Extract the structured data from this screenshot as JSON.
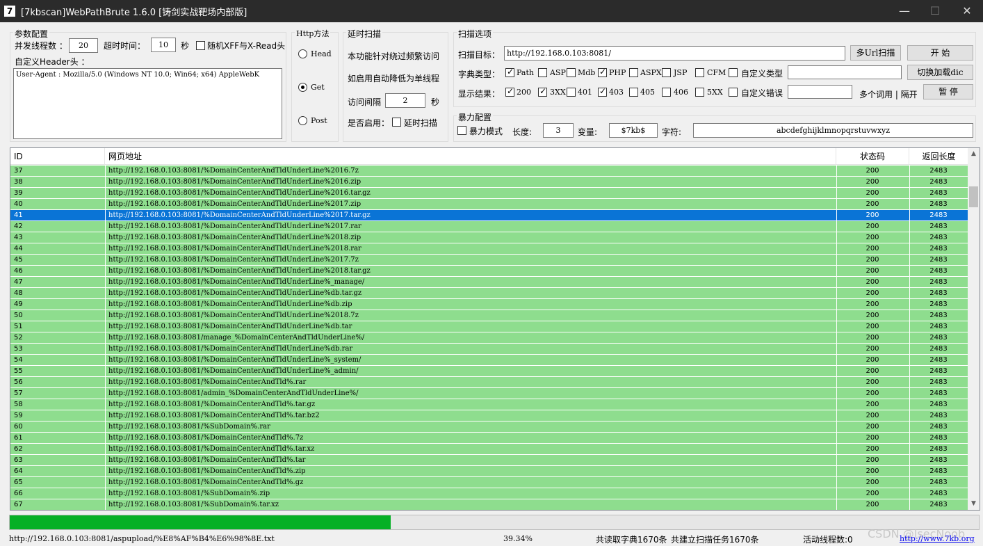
{
  "window": {
    "title": "[7kbscan]WebPathBrute 1.6.0 [铸剑实战靶场内部版]",
    "icon_label": "7",
    "minimize": "—",
    "maximize": "☐",
    "close": "✕"
  },
  "params": {
    "legend": "参数配置",
    "threads_label": "并发线程数 ：",
    "threads_value": "20",
    "timeout_label": "超时时间：",
    "timeout_value": "10",
    "timeout_unit": "秒",
    "random_xff_label": "随机XFF与X-Read头",
    "random_xff_checked": false,
    "header_label": "自定义Header头 ：",
    "header_value": "User-Agent : Mozilla/5.0 (Windows NT 10.0; Win64; x64) AppleWebK"
  },
  "http": {
    "legend": "Http方法",
    "options": [
      {
        "label": "Head",
        "checked": false
      },
      {
        "label": "Get",
        "checked": true
      },
      {
        "label": "Post",
        "checked": false
      }
    ]
  },
  "delay": {
    "legend": "延时扫描",
    "desc1": "本功能针对绕过频繁访问",
    "desc2": "如启用自动降低为单线程",
    "interval_label": "访问间隔",
    "interval_value": "2",
    "interval_unit": "秒",
    "enable_label": "是否启用：",
    "enable_checkbox_label": "延时扫描",
    "enable_checked": false
  },
  "scan": {
    "legend": "扫描选项",
    "target_label": "扫描目标：",
    "target_value": "http://192.168.0.103:8081/",
    "multi_url_button": "多Url扫描",
    "start_button": "开 始",
    "dict_label": "字典类型：",
    "dict_types": [
      {
        "label": "Path",
        "checked": true
      },
      {
        "label": "ASP",
        "checked": false
      },
      {
        "label": "Mdb",
        "checked": false
      },
      {
        "label": "PHP",
        "checked": true
      },
      {
        "label": "ASPX",
        "checked": false
      },
      {
        "label": "JSP",
        "checked": false
      },
      {
        "label": "CFM",
        "checked": false
      }
    ],
    "custom_type_label": "自定义类型",
    "custom_type_checked": false,
    "custom_type_value": "",
    "switch_dict_button": "切换加载dic",
    "result_label": "显示结果：",
    "result_codes": [
      {
        "label": "200",
        "checked": true
      },
      {
        "label": "3XX",
        "checked": true
      },
      {
        "label": "401",
        "checked": false
      },
      {
        "label": "403",
        "checked": true
      },
      {
        "label": "405",
        "checked": false
      },
      {
        "label": "406",
        "checked": false
      },
      {
        "label": "5XX",
        "checked": false
      }
    ],
    "custom_error_label": "自定义错误",
    "custom_error_checked": false,
    "custom_error_value": "",
    "multi_word_label": "多个词用 | 隔开",
    "pause_button": "暂 停"
  },
  "brute": {
    "legend": "暴力配置",
    "mode_label": "暴力模式",
    "mode_checked": false,
    "length_label": "长度:",
    "length_value": "3",
    "variable_label": "变量:",
    "variable_value": "$7kb$",
    "chars_label": "字符:",
    "chars_value": "abcdefghijklmnopqrstuvwxyz"
  },
  "table": {
    "headers": {
      "id": "ID",
      "url": "网页地址",
      "status": "状态码",
      "length": "返回长度"
    },
    "selected_id": "41",
    "rows": [
      {
        "id": "37",
        "url": "http://192.168.0.103:8081/%DomainCenterAndTldUnderLine%2016.7z",
        "status": "200",
        "length": "2483"
      },
      {
        "id": "38",
        "url": "http://192.168.0.103:8081/%DomainCenterAndTldUnderLine%2016.zip",
        "status": "200",
        "length": "2483"
      },
      {
        "id": "39",
        "url": "http://192.168.0.103:8081/%DomainCenterAndTldUnderLine%2016.tar.gz",
        "status": "200",
        "length": "2483"
      },
      {
        "id": "40",
        "url": "http://192.168.0.103:8081/%DomainCenterAndTldUnderLine%2017.zip",
        "status": "200",
        "length": "2483"
      },
      {
        "id": "41",
        "url": "http://192.168.0.103:8081/%DomainCenterAndTldUnderLine%2017.tar.gz",
        "status": "200",
        "length": "2483"
      },
      {
        "id": "42",
        "url": "http://192.168.0.103:8081/%DomainCenterAndTldUnderLine%2017.rar",
        "status": "200",
        "length": "2483"
      },
      {
        "id": "43",
        "url": "http://192.168.0.103:8081/%DomainCenterAndTldUnderLine%2018.zip",
        "status": "200",
        "length": "2483"
      },
      {
        "id": "44",
        "url": "http://192.168.0.103:8081/%DomainCenterAndTldUnderLine%2018.rar",
        "status": "200",
        "length": "2483"
      },
      {
        "id": "45",
        "url": "http://192.168.0.103:8081/%DomainCenterAndTldUnderLine%2017.7z",
        "status": "200",
        "length": "2483"
      },
      {
        "id": "46",
        "url": "http://192.168.0.103:8081/%DomainCenterAndTldUnderLine%2018.tar.gz",
        "status": "200",
        "length": "2483"
      },
      {
        "id": "47",
        "url": "http://192.168.0.103:8081/%DomainCenterAndTldUnderLine%_manage/",
        "status": "200",
        "length": "2483"
      },
      {
        "id": "48",
        "url": "http://192.168.0.103:8081/%DomainCenterAndTldUnderLine%db.tar.gz",
        "status": "200",
        "length": "2483"
      },
      {
        "id": "49",
        "url": "http://192.168.0.103:8081/%DomainCenterAndTldUnderLine%db.zip",
        "status": "200",
        "length": "2483"
      },
      {
        "id": "50",
        "url": "http://192.168.0.103:8081/%DomainCenterAndTldUnderLine%2018.7z",
        "status": "200",
        "length": "2483"
      },
      {
        "id": "51",
        "url": "http://192.168.0.103:8081/%DomainCenterAndTldUnderLine%db.tar",
        "status": "200",
        "length": "2483"
      },
      {
        "id": "52",
        "url": "http://192.168.0.103:8081/manage_%DomainCenterAndTldUnderLine%/",
        "status": "200",
        "length": "2483"
      },
      {
        "id": "53",
        "url": "http://192.168.0.103:8081/%DomainCenterAndTldUnderLine%db.rar",
        "status": "200",
        "length": "2483"
      },
      {
        "id": "54",
        "url": "http://192.168.0.103:8081/%DomainCenterAndTldUnderLine%_system/",
        "status": "200",
        "length": "2483"
      },
      {
        "id": "55",
        "url": "http://192.168.0.103:8081/%DomainCenterAndTldUnderLine%_admin/",
        "status": "200",
        "length": "2483"
      },
      {
        "id": "56",
        "url": "http://192.168.0.103:8081/%DomainCenterAndTld%.rar",
        "status": "200",
        "length": "2483"
      },
      {
        "id": "57",
        "url": "http://192.168.0.103:8081/admin_%DomainCenterAndTldUnderLine%/",
        "status": "200",
        "length": "2483"
      },
      {
        "id": "58",
        "url": "http://192.168.0.103:8081/%DomainCenterAndTld%.tar.gz",
        "status": "200",
        "length": "2483"
      },
      {
        "id": "59",
        "url": "http://192.168.0.103:8081/%DomainCenterAndTld%.tar.bz2",
        "status": "200",
        "length": "2483"
      },
      {
        "id": "60",
        "url": "http://192.168.0.103:8081/%SubDomain%.rar",
        "status": "200",
        "length": "2483"
      },
      {
        "id": "61",
        "url": "http://192.168.0.103:8081/%DomainCenterAndTld%.7z",
        "status": "200",
        "length": "2483"
      },
      {
        "id": "62",
        "url": "http://192.168.0.103:8081/%DomainCenterAndTld%.tar.xz",
        "status": "200",
        "length": "2483"
      },
      {
        "id": "63",
        "url": "http://192.168.0.103:8081/%DomainCenterAndTld%.tar",
        "status": "200",
        "length": "2483"
      },
      {
        "id": "64",
        "url": "http://192.168.0.103:8081/%DomainCenterAndTld%.zip",
        "status": "200",
        "length": "2483"
      },
      {
        "id": "65",
        "url": "http://192.168.0.103:8081/%DomainCenterAndTld%.gz",
        "status": "200",
        "length": "2483"
      },
      {
        "id": "66",
        "url": "http://192.168.0.103:8081/%SubDomain%.zip",
        "status": "200",
        "length": "2483"
      },
      {
        "id": "67",
        "url": "http://192.168.0.103:8081/%SubDomain%.tar.xz",
        "status": "200",
        "length": "2483"
      }
    ]
  },
  "progress": {
    "fraction": 0.3934
  },
  "statusbar": {
    "current_url": "http://192.168.0.103:8081/aspupload/%E8%AF%B4%E6%98%8E.txt",
    "percent": "39.34%",
    "dict_count": "共读取字典1670条",
    "task_count": "共建立扫描任务1670条",
    "active_threads": "活动线程数:0",
    "watermark": "CSDN @IsecNoob",
    "link": "http://www.7kb.org"
  },
  "colors": {
    "row_green": "#8edd8e",
    "row_selected": "#0a74d6",
    "progress_green": "#06b025",
    "titlebar": "#2b2b2b"
  }
}
